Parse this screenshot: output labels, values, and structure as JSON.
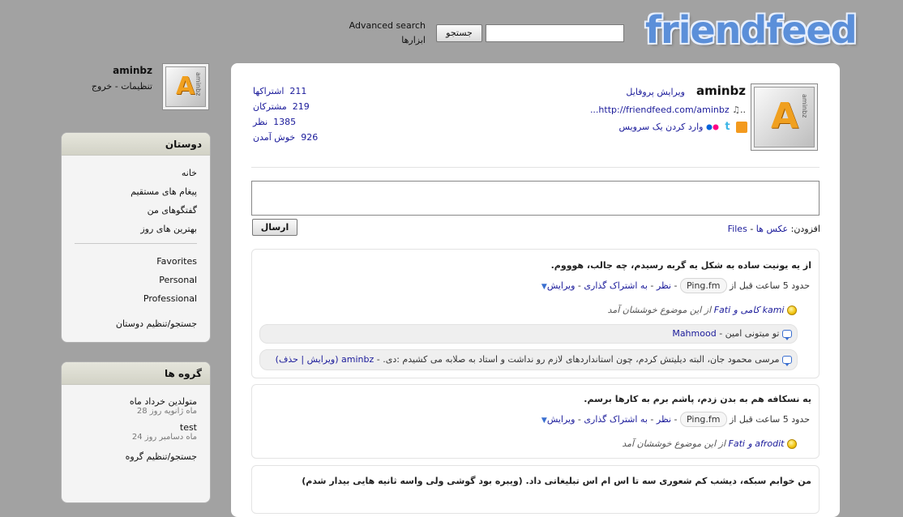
{
  "header": {
    "logo": "friendfeed",
    "search_button": "جستجو",
    "search_value": "",
    "advanced_search": "Advanced search",
    "tools": "ابزارها"
  },
  "current_user": {
    "name": "aminbz",
    "settings": "تنظیمات",
    "separator": "-",
    "logout": "خروج",
    "avatar_letter": "A",
    "avatar_sub": "aminbz"
  },
  "friends_box": {
    "title": "دوستان",
    "items": [
      "خانه",
      "پیغام های مستقیم",
      "گفتگوهای من",
      "بهترین های روز"
    ],
    "lists": [
      "Favorites",
      "Personal",
      "Professional"
    ],
    "manage": "جستجو/تنظیم دوستان"
  },
  "groups_box": {
    "title": "گروه ها",
    "groups": [
      {
        "name": "متولدین خرداد ماه",
        "date": "ماه ژانویه روز 28"
      },
      {
        "name": "test",
        "date": "ماه دسامبر روز 24"
      }
    ],
    "manage": "جستجو/تنظیم گروه"
  },
  "profile": {
    "name": "aminbz",
    "edit_profile": "ویرایش پروفایل",
    "url": "...http://friendfeed.com/aminbz",
    "url_prefix": "..",
    "add_service": "وارد کردن یک سرویس",
    "stats": [
      {
        "num": "211",
        "label": "اشتراکها"
      },
      {
        "num": "219",
        "label": "مشترکان"
      },
      {
        "num": "1385",
        "label": "نظر"
      },
      {
        "num": "926",
        "label": "خوش آمدن"
      }
    ]
  },
  "composer": {
    "send": "ارسال",
    "add_label": "افزودن:",
    "add_photo": "عکس ها",
    "dash": "-",
    "add_files": "Files"
  },
  "entries": [
    {
      "title": "از یه یونیت ساده به شکل یه گربه رسیدم، چه جالب، هوووم.",
      "time": "حدود 5 ساعت قبل",
      "from": "از",
      "source": "Ping.fm",
      "actions": [
        "نظر",
        "به اشتراک گذاری",
        "ویرایش"
      ],
      "likers": "kami کامی و Fati",
      "likes_suffix": "از این موضوع خوششان آمد",
      "comments": [
        {
          "text": "تو میتونی امین",
          "author": "Mahmood",
          "extra": ""
        },
        {
          "text": "مرسی محمود جان، البته دیلیتش کردم، چون استانداردهای لازم رو نداشت و استاد به صلابه می کشیدم :دی.",
          "author": "aminbz",
          "extra": "(ویرایش | حذف)"
        }
      ]
    },
    {
      "title": "یه نسکافه هم به بدن زدم، پاشم برم به کارها برسم.",
      "time": "حدود 5 ساعت قبل",
      "from": "از",
      "source": "Ping.fm",
      "actions": [
        "نظر",
        "به اشتراک گذاری",
        "ویرایش"
      ],
      "likers": "afrodit و Fati",
      "likes_suffix": "از این موضوع خوششان آمد",
      "comments": []
    },
    {
      "title": "من خوابم سبکه، دیشب کم شعوری سه تا اس ام اس تبلیغاتی داد. (ویبره بود گوشی ولی واسه ثانیه هایی بیدار شدم)",
      "comments": []
    }
  ],
  "colors": {
    "background": "#a2a2a2",
    "link": "#1a1a9a",
    "logo": "#5b8fd9"
  }
}
